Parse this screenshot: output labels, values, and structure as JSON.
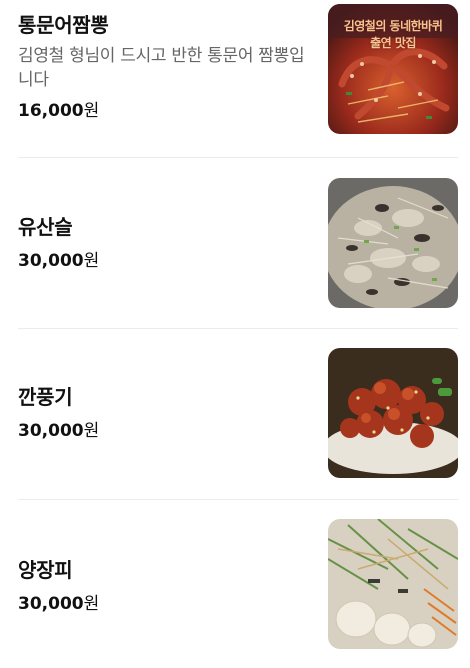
{
  "menu": {
    "items": [
      {
        "name": "통문어짬뽕",
        "description": "김영철 형님이 드시고 반한 통문어 짬뽕입니다",
        "price": "16,000",
        "currency": "원",
        "image_caption_line1": "김영철의 동네한바퀴",
        "image_caption_line2": "출연 맛집",
        "image_icon": "octopus-jjamppong-photo"
      },
      {
        "name": "유산슬",
        "price": "30,000",
        "currency": "원",
        "image_icon": "yusanseul-photo"
      },
      {
        "name": "깐풍기",
        "price": "30,000",
        "currency": "원",
        "image_icon": "kkanpunggi-photo"
      },
      {
        "name": "양장피",
        "price": "30,000",
        "currency": "원",
        "image_icon": "yangjangpi-photo"
      }
    ]
  }
}
